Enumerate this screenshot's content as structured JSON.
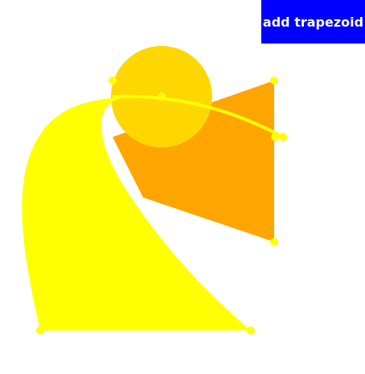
{
  "toolbar": {
    "add_button_label": "add trapezoid"
  },
  "colors": {
    "background": "#ffffff",
    "button_bg": "#0000ff",
    "button_text": "#ffffff",
    "trapezoid_fill": "#ffa500",
    "circle_fill": "#ffd700",
    "curved_shape_fill": "#ffff00",
    "handle_fill": "#ffff00"
  }
}
